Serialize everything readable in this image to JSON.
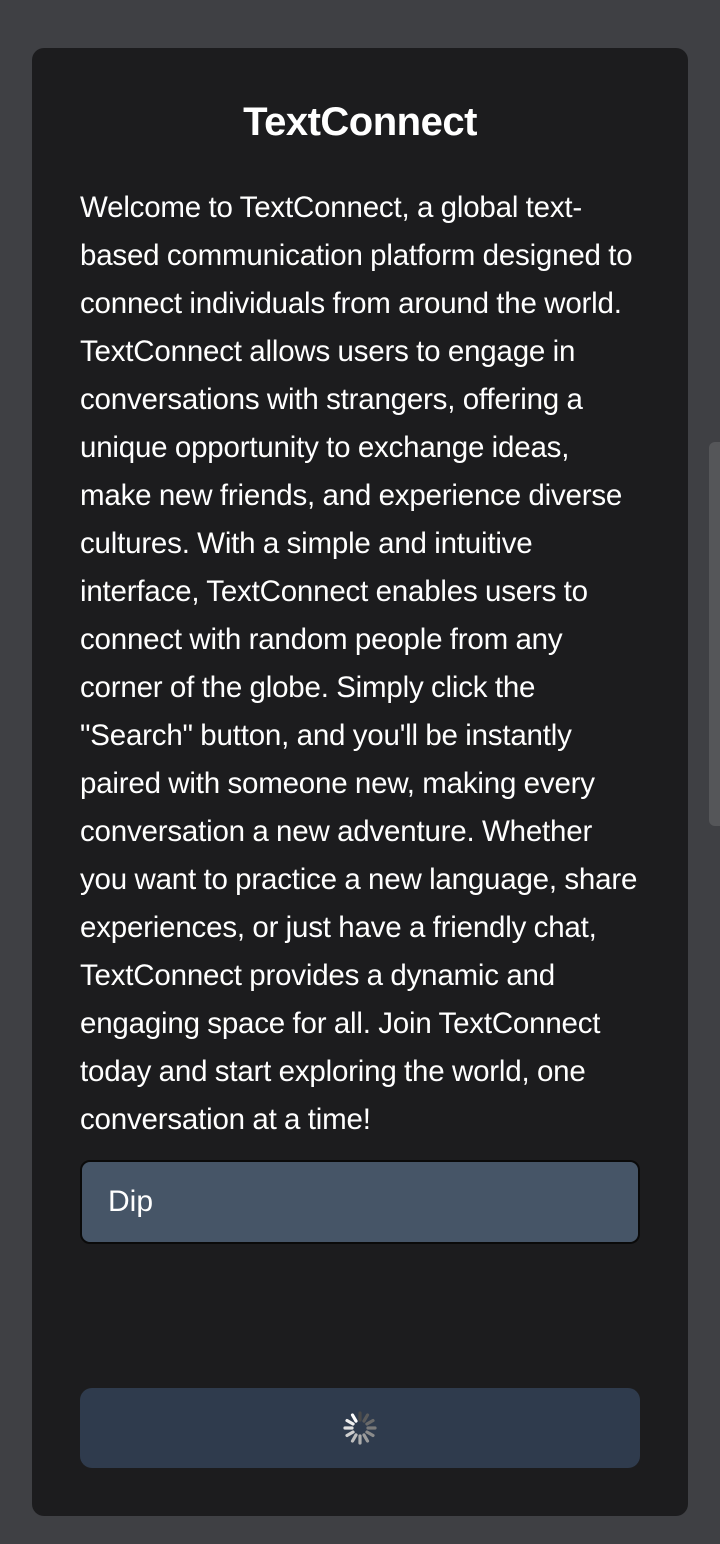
{
  "app": {
    "title": "TextConnect"
  },
  "intro": {
    "description": "Welcome to TextConnect, a global text-based communication platform designed to connect individuals from around the world. TextConnect allows users to engage in conversations with strangers, offering a unique opportunity to exchange ideas, make new friends, and experience diverse cultures. With a simple and intuitive interface, TextConnect enables users to connect with random people from any corner of the globe. Simply click the \"Search\" button, and you'll be instantly paired with someone new, making every conversation a new adventure. Whether you want to practice a new language, share experiences, or just have a friendly chat, TextConnect provides a dynamic and engaging space for all. Join TextConnect today and start exploring the world, one conversation at a time!"
  },
  "form": {
    "name_value": "Dip",
    "search_button": {
      "state": "loading",
      "icon": "spinner-icon"
    }
  },
  "colors": {
    "page_background": "#3f4044",
    "card_background": "#1c1c1e",
    "input_background": "#465567",
    "button_background": "#2f3b4d",
    "text": "#ffffff"
  }
}
